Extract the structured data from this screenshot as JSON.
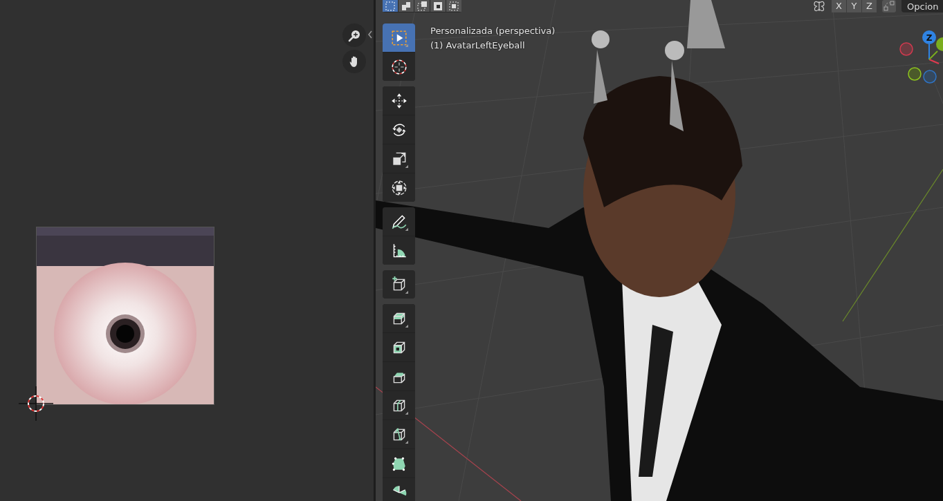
{
  "image_editor": {
    "nav_buttons": [
      {
        "kind": "zoom"
      },
      {
        "kind": "pan"
      }
    ]
  },
  "viewport": {
    "header": {
      "select_modes": [
        {
          "kind": "new",
          "selected": true
        },
        {
          "kind": "extend",
          "selected": false
        },
        {
          "kind": "subtract",
          "selected": false
        },
        {
          "kind": "invert",
          "selected": false
        },
        {
          "kind": "intersect",
          "selected": false
        }
      ],
      "mirror_axes": [
        "X",
        "Y",
        "Z"
      ],
      "options_label": "Opcion"
    },
    "overlay_text": [
      "Personalizada (perspectiva)",
      "(1) AvatarLeftEyeball"
    ],
    "tool_groups": [
      [
        {
          "kind": "select-box",
          "selected": true
        },
        {
          "kind": "cursor",
          "selected": false
        }
      ],
      [
        {
          "kind": "move",
          "selected": false
        },
        {
          "kind": "rotate",
          "selected": false
        },
        {
          "kind": "scale",
          "selected": false
        },
        {
          "kind": "transform",
          "selected": false
        }
      ],
      [
        {
          "kind": "annotate",
          "selected": false
        },
        {
          "kind": "measure",
          "selected": false
        }
      ],
      [
        {
          "kind": "add-cube",
          "selected": false
        }
      ],
      [
        {
          "kind": "extrude",
          "selected": false
        },
        {
          "kind": "inset",
          "selected": false
        },
        {
          "kind": "bevel",
          "selected": false
        },
        {
          "kind": "loop-cut",
          "selected": false
        },
        {
          "kind": "knife",
          "selected": false
        },
        {
          "kind": "poly-build",
          "selected": false
        },
        {
          "kind": "spin",
          "selected": false
        }
      ]
    ],
    "gizmo": {
      "up_axis_label": "Z"
    }
  }
}
